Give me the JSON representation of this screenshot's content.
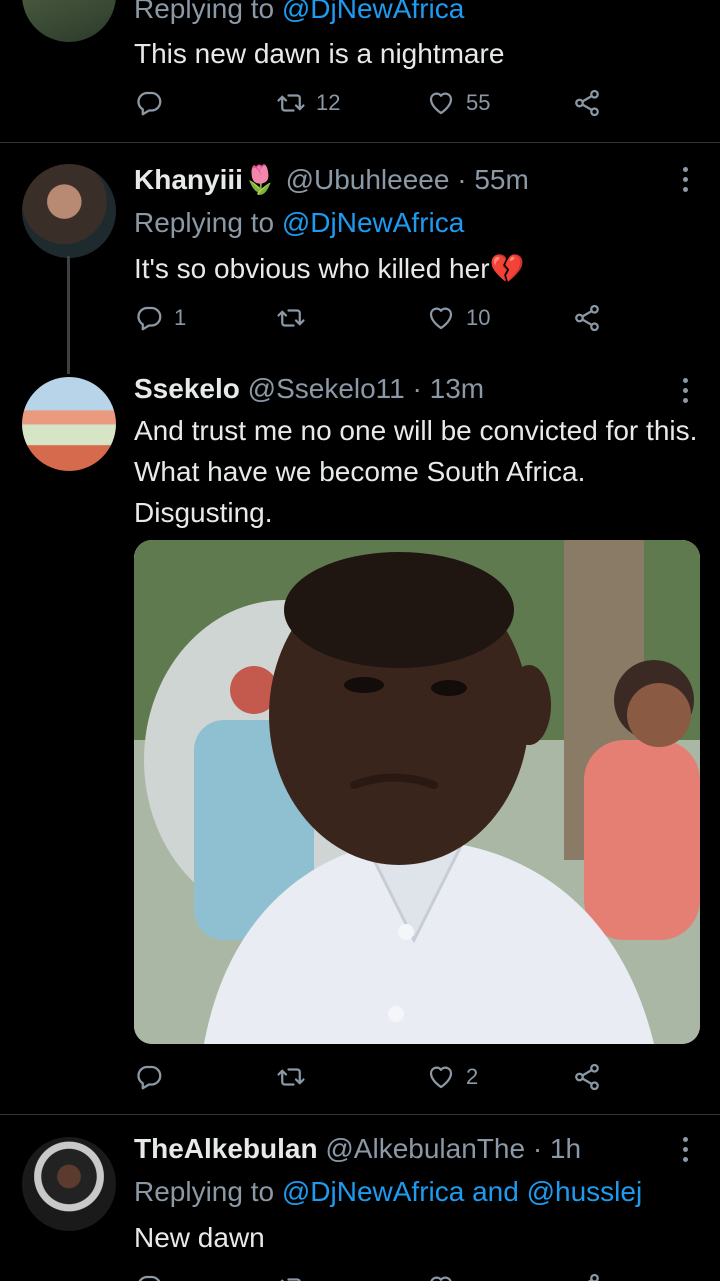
{
  "tweets": [
    {
      "replying_prefix": "Replying to",
      "replying_to": "@DjNewAfrica",
      "text": "This new dawn is a nightmare",
      "replies": "",
      "retweets": "12",
      "likes": "55"
    },
    {
      "name": "Khanyiii🌷",
      "handle": "@Ubuhleeee",
      "dot": "·",
      "time": "55m",
      "replying_prefix": "Replying to",
      "replying_to": "@DjNewAfrica",
      "text": "It's so obvious who killed her💔",
      "replies": "1",
      "retweets": "",
      "likes": "10"
    },
    {
      "name": "Ssekelo",
      "handle": "@Ssekelo11",
      "dot": "·",
      "time": "13m",
      "text": "And trust me no one will be convicted for this.  What have we become South Africa. Disgusting.",
      "replies": "",
      "retweets": "",
      "likes": "2"
    },
    {
      "name": "TheAlkebulan",
      "handle": "@AlkebulanThe",
      "dot": "·",
      "time": "1h",
      "replying_prefix": "Replying to",
      "replying_to": "@DjNewAfrica and @husslej",
      "text": "New dawn"
    }
  ],
  "icons": {
    "reply": "reply-icon",
    "retweet": "retweet-icon",
    "like": "heart-icon",
    "share": "share-icon",
    "more": "more-icon"
  },
  "colors": {
    "background": "#000000",
    "text": "#e7e9ea",
    "secondary": "#8b98a5",
    "link": "#1d9bf0",
    "divider": "#2f3336"
  }
}
